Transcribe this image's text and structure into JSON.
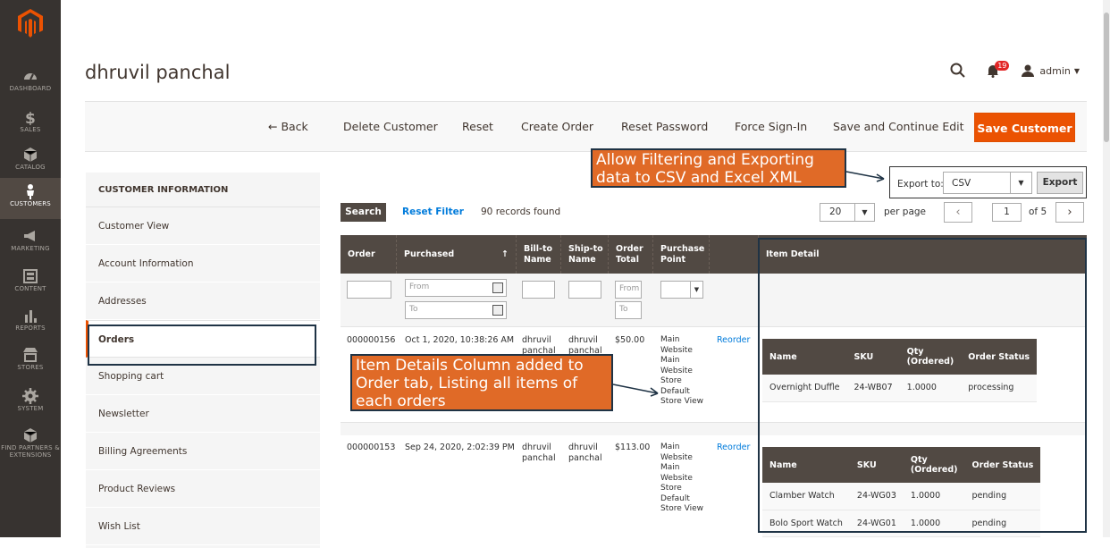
{
  "nav": {
    "items": [
      {
        "label": "DASHBOARD",
        "icon": "dashboard-icon"
      },
      {
        "label": "SALES",
        "icon": "dollar-icon"
      },
      {
        "label": "CATALOG",
        "icon": "box-icon"
      },
      {
        "label": "CUSTOMERS",
        "icon": "person-icon"
      },
      {
        "label": "MARKETING",
        "icon": "megaphone-icon"
      },
      {
        "label": "CONTENT",
        "icon": "layout-icon"
      },
      {
        "label": "REPORTS",
        "icon": "bar-chart-icon"
      },
      {
        "label": "STORES",
        "icon": "storefront-icon"
      },
      {
        "label": "SYSTEM",
        "icon": "gear-icon"
      },
      {
        "label": "FIND PARTNERS & EXTENSIONS",
        "icon": "cube-icon"
      }
    ],
    "active": "CUSTOMERS"
  },
  "header": {
    "title": "dhruvil panchal",
    "notification_count": "19",
    "user": "admin"
  },
  "actions": {
    "back": "← Back",
    "delete": "Delete Customer",
    "reset": "Reset",
    "create_order": "Create Order",
    "reset_password": "Reset Password",
    "force_signin": "Force Sign-In",
    "save_continue": "Save and Continue Edit",
    "save": "Save Customer"
  },
  "customer_info": {
    "heading": "CUSTOMER INFORMATION",
    "items": [
      "Customer View",
      "Account Information",
      "Addresses",
      "Orders",
      "Shopping cart",
      "Newsletter",
      "Billing Agreements",
      "Product Reviews",
      "Wish List"
    ],
    "active": "Orders"
  },
  "grid": {
    "search": "Search",
    "reset_filter": "Reset Filter",
    "records": "90 records found",
    "per_page_value": "20",
    "per_page_label": "per page",
    "page": "1",
    "of_pages": "of 5",
    "export_label": "Export to:",
    "export_value": "CSV",
    "export_button": "Export",
    "columns": [
      "Order",
      "Purchased",
      "Bill-to Name",
      "Ship-to Name",
      "Order Total",
      "Purchase Point",
      "",
      "Item Detail"
    ],
    "filter": {
      "from": "From",
      "to": "To"
    },
    "detail_columns": [
      "Name",
      "SKU",
      "Qty (Ordered)",
      "Order Status"
    ],
    "rows": [
      {
        "order": "000000156",
        "purchased": "Oct 1, 2020, 10:38:26 AM",
        "bill": "dhruvil panchal",
        "ship": "dhruvil panchal",
        "total": "$50.00",
        "point": "Main Website Main Website Store Default Store View",
        "action": "Reorder",
        "items": [
          {
            "name": "Overnight Duffle",
            "sku": "24-WB07",
            "qty": "1.0000",
            "status": "processing"
          }
        ]
      },
      {
        "order": "000000153",
        "purchased": "Sep 24, 2020, 2:02:39 PM",
        "bill": "dhruvil panchal",
        "ship": "dhruvil panchal",
        "total": "$113.00",
        "point": "Main Website Main Website Store Default Store View",
        "action": "Reorder",
        "items": [
          {
            "name": "Clamber Watch",
            "sku": "24-WG03",
            "qty": "1.0000",
            "status": "pending"
          },
          {
            "name": "Bolo Sport Watch",
            "sku": "24-WG01",
            "qty": "1.0000",
            "status": "pending"
          }
        ]
      }
    ]
  },
  "callouts": {
    "export": "Allow Filtering and Exporting data to CSV and Excel XML",
    "detail": "Item Details Column added to Order tab, Listing all items of each orders"
  },
  "colors": {
    "accent": "#eb5202",
    "dark": "#514943",
    "nav": "#373330",
    "callout": "#e06a27",
    "link": "#007bdb"
  }
}
